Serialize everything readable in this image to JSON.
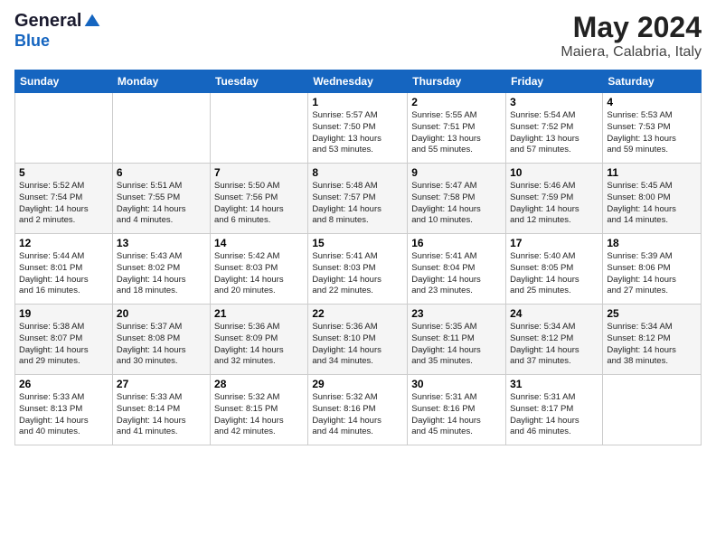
{
  "header": {
    "logo": {
      "general": "General",
      "blue": "Blue"
    },
    "title": "May 2024",
    "subtitle": "Maiera, Calabria, Italy"
  },
  "calendar": {
    "weekdays": [
      "Sunday",
      "Monday",
      "Tuesday",
      "Wednesday",
      "Thursday",
      "Friday",
      "Saturday"
    ],
    "weeks": [
      [
        {
          "day": "",
          "info": ""
        },
        {
          "day": "",
          "info": ""
        },
        {
          "day": "",
          "info": ""
        },
        {
          "day": "1",
          "info": "Sunrise: 5:57 AM\nSunset: 7:50 PM\nDaylight: 13 hours\nand 53 minutes."
        },
        {
          "day": "2",
          "info": "Sunrise: 5:55 AM\nSunset: 7:51 PM\nDaylight: 13 hours\nand 55 minutes."
        },
        {
          "day": "3",
          "info": "Sunrise: 5:54 AM\nSunset: 7:52 PM\nDaylight: 13 hours\nand 57 minutes."
        },
        {
          "day": "4",
          "info": "Sunrise: 5:53 AM\nSunset: 7:53 PM\nDaylight: 13 hours\nand 59 minutes."
        }
      ],
      [
        {
          "day": "5",
          "info": "Sunrise: 5:52 AM\nSunset: 7:54 PM\nDaylight: 14 hours\nand 2 minutes."
        },
        {
          "day": "6",
          "info": "Sunrise: 5:51 AM\nSunset: 7:55 PM\nDaylight: 14 hours\nand 4 minutes."
        },
        {
          "day": "7",
          "info": "Sunrise: 5:50 AM\nSunset: 7:56 PM\nDaylight: 14 hours\nand 6 minutes."
        },
        {
          "day": "8",
          "info": "Sunrise: 5:48 AM\nSunset: 7:57 PM\nDaylight: 14 hours\nand 8 minutes."
        },
        {
          "day": "9",
          "info": "Sunrise: 5:47 AM\nSunset: 7:58 PM\nDaylight: 14 hours\nand 10 minutes."
        },
        {
          "day": "10",
          "info": "Sunrise: 5:46 AM\nSunset: 7:59 PM\nDaylight: 14 hours\nand 12 minutes."
        },
        {
          "day": "11",
          "info": "Sunrise: 5:45 AM\nSunset: 8:00 PM\nDaylight: 14 hours\nand 14 minutes."
        }
      ],
      [
        {
          "day": "12",
          "info": "Sunrise: 5:44 AM\nSunset: 8:01 PM\nDaylight: 14 hours\nand 16 minutes."
        },
        {
          "day": "13",
          "info": "Sunrise: 5:43 AM\nSunset: 8:02 PM\nDaylight: 14 hours\nand 18 minutes."
        },
        {
          "day": "14",
          "info": "Sunrise: 5:42 AM\nSunset: 8:03 PM\nDaylight: 14 hours\nand 20 minutes."
        },
        {
          "day": "15",
          "info": "Sunrise: 5:41 AM\nSunset: 8:03 PM\nDaylight: 14 hours\nand 22 minutes."
        },
        {
          "day": "16",
          "info": "Sunrise: 5:41 AM\nSunset: 8:04 PM\nDaylight: 14 hours\nand 23 minutes."
        },
        {
          "day": "17",
          "info": "Sunrise: 5:40 AM\nSunset: 8:05 PM\nDaylight: 14 hours\nand 25 minutes."
        },
        {
          "day": "18",
          "info": "Sunrise: 5:39 AM\nSunset: 8:06 PM\nDaylight: 14 hours\nand 27 minutes."
        }
      ],
      [
        {
          "day": "19",
          "info": "Sunrise: 5:38 AM\nSunset: 8:07 PM\nDaylight: 14 hours\nand 29 minutes."
        },
        {
          "day": "20",
          "info": "Sunrise: 5:37 AM\nSunset: 8:08 PM\nDaylight: 14 hours\nand 30 minutes."
        },
        {
          "day": "21",
          "info": "Sunrise: 5:36 AM\nSunset: 8:09 PM\nDaylight: 14 hours\nand 32 minutes."
        },
        {
          "day": "22",
          "info": "Sunrise: 5:36 AM\nSunset: 8:10 PM\nDaylight: 14 hours\nand 34 minutes."
        },
        {
          "day": "23",
          "info": "Sunrise: 5:35 AM\nSunset: 8:11 PM\nDaylight: 14 hours\nand 35 minutes."
        },
        {
          "day": "24",
          "info": "Sunrise: 5:34 AM\nSunset: 8:12 PM\nDaylight: 14 hours\nand 37 minutes."
        },
        {
          "day": "25",
          "info": "Sunrise: 5:34 AM\nSunset: 8:12 PM\nDaylight: 14 hours\nand 38 minutes."
        }
      ],
      [
        {
          "day": "26",
          "info": "Sunrise: 5:33 AM\nSunset: 8:13 PM\nDaylight: 14 hours\nand 40 minutes."
        },
        {
          "day": "27",
          "info": "Sunrise: 5:33 AM\nSunset: 8:14 PM\nDaylight: 14 hours\nand 41 minutes."
        },
        {
          "day": "28",
          "info": "Sunrise: 5:32 AM\nSunset: 8:15 PM\nDaylight: 14 hours\nand 42 minutes."
        },
        {
          "day": "29",
          "info": "Sunrise: 5:32 AM\nSunset: 8:16 PM\nDaylight: 14 hours\nand 44 minutes."
        },
        {
          "day": "30",
          "info": "Sunrise: 5:31 AM\nSunset: 8:16 PM\nDaylight: 14 hours\nand 45 minutes."
        },
        {
          "day": "31",
          "info": "Sunrise: 5:31 AM\nSunset: 8:17 PM\nDaylight: 14 hours\nand 46 minutes."
        },
        {
          "day": "",
          "info": ""
        }
      ]
    ]
  }
}
